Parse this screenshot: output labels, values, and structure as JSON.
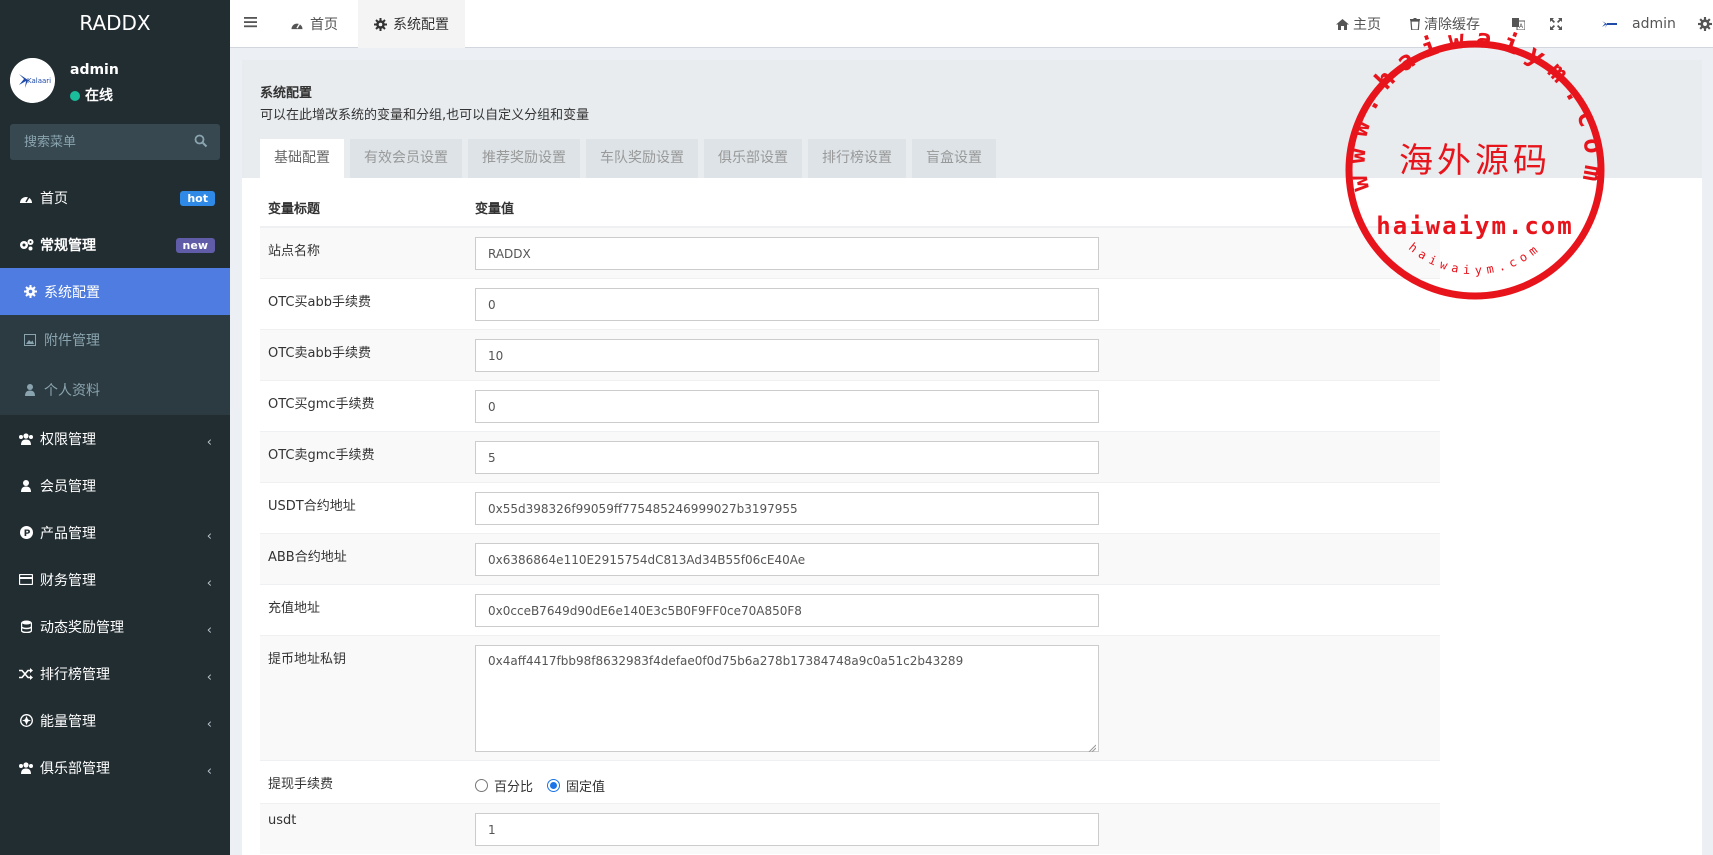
{
  "sidebar": {
    "logo": "RADDX",
    "user": {
      "name": "admin",
      "status": "在线",
      "avatar_text": "Kalaari"
    },
    "search_placeholder": "搜索菜单",
    "menu": [
      {
        "label": "首页",
        "badge": "hot",
        "icon": "dashboard-icon"
      },
      {
        "label": "常规管理",
        "badge": "new",
        "icon": "cogs-icon"
      },
      {
        "label": "系统配置",
        "icon": "gear-icon"
      },
      {
        "label": "附件管理",
        "icon": "image-icon"
      },
      {
        "label": "个人资料",
        "icon": "user-icon"
      },
      {
        "label": "权限管理",
        "icon": "users-icon"
      },
      {
        "label": "会员管理",
        "icon": "user-icon"
      },
      {
        "label": "产品管理",
        "icon": "product-icon"
      },
      {
        "label": "财务管理",
        "icon": "credit-card-icon"
      },
      {
        "label": "动态奖励管理",
        "icon": "database-icon"
      },
      {
        "label": "排行榜管理",
        "icon": "random-icon"
      },
      {
        "label": "能量管理",
        "icon": "energy-icon"
      },
      {
        "label": "俱乐部管理",
        "icon": "users-icon"
      }
    ]
  },
  "header": {
    "tabs": [
      {
        "label": "首页",
        "icon": "dashboard-icon"
      },
      {
        "label": "系统配置",
        "icon": "gear-icon"
      }
    ],
    "right": {
      "home": "主页",
      "clear_cache": "清除缓存",
      "user": "admin"
    }
  },
  "page": {
    "title": "系统配置",
    "description": "可以在此增改系统的变量和分组,也可以自定义分组和变量",
    "tabs": [
      "基础配置",
      "有效会员设置",
      "推荐奖励设置",
      "车队奖励设置",
      "俱乐部设置",
      "排行榜设置",
      "盲盒设置"
    ],
    "columns": [
      "变量标题",
      "变量值"
    ],
    "rows": [
      {
        "label": "站点名称",
        "value": "RADDX"
      },
      {
        "label": "OTC买abb手续费",
        "value": "0"
      },
      {
        "label": "OTC卖abb手续费",
        "value": "10"
      },
      {
        "label": "OTC买gmc手续费",
        "value": "0"
      },
      {
        "label": "OTC卖gmc手续费",
        "value": "5"
      },
      {
        "label": "USDT合约地址",
        "value": "0x55d398326f99059ff775485246999027b3197955"
      },
      {
        "label": "ABB合约地址",
        "value": "0x6386864e110E2915754dC813Ad34B55f06cE40Ae"
      },
      {
        "label": "充值地址",
        "value": "0x0cceB7649d90dE6e140E3c5B0F9FF0ce70A850F8"
      },
      {
        "label": "提币地址私钥",
        "value": "0x4aff4417fbb98f8632983f4defae0f0d75b6a278b17384748a9c0a51c2b43289"
      },
      {
        "label": "提现手续费",
        "options": [
          "百分比",
          "固定值"
        ],
        "selected": "固定值"
      },
      {
        "label": "usdt",
        "value": "1"
      }
    ]
  },
  "watermark": {
    "top_text": "www.haiwaiym.com",
    "center_text": "海外源码",
    "domain_text": "haiwaiym.com",
    "bottom_text": "haiwaiym.com",
    "color": "#e8141c"
  }
}
